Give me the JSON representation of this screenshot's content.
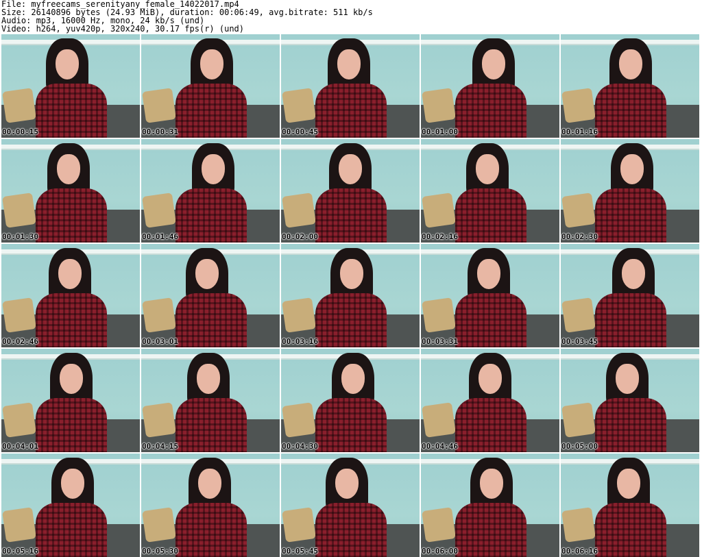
{
  "header": {
    "file_line": "File: myfreecams_serenityany_female_14022017.mp4",
    "size_line": "Size: 26140896 bytes (24.93 MiB), duration: 00:06:49, avg.bitrate: 511 kb/s",
    "audio_line": "Audio: mp3, 16000 Hz, mono, 24 kb/s (und)",
    "video_line": "Video: h264, yuv420p, 320x240, 30.17 fps(r) (und)"
  },
  "thumbnails": [
    {
      "timestamp": "00:00:15"
    },
    {
      "timestamp": "00:00:31"
    },
    {
      "timestamp": "00:00:45"
    },
    {
      "timestamp": "00:01:00"
    },
    {
      "timestamp": "00:01:16"
    },
    {
      "timestamp": "00:01:30"
    },
    {
      "timestamp": "00:01:46"
    },
    {
      "timestamp": "00:02:00"
    },
    {
      "timestamp": "00:02:16"
    },
    {
      "timestamp": "00:02:30"
    },
    {
      "timestamp": "00:02:46"
    },
    {
      "timestamp": "00:03:01"
    },
    {
      "timestamp": "00:03:16"
    },
    {
      "timestamp": "00:03:31"
    },
    {
      "timestamp": "00:03:45"
    },
    {
      "timestamp": "00:04:01"
    },
    {
      "timestamp": "00:04:15"
    },
    {
      "timestamp": "00:04:30"
    },
    {
      "timestamp": "00:04:46"
    },
    {
      "timestamp": "00:05:00"
    },
    {
      "timestamp": "00:05:16"
    },
    {
      "timestamp": "00:05:30"
    },
    {
      "timestamp": "00:05:45"
    },
    {
      "timestamp": "00:06:00"
    },
    {
      "timestamp": "00:06:16"
    }
  ]
}
